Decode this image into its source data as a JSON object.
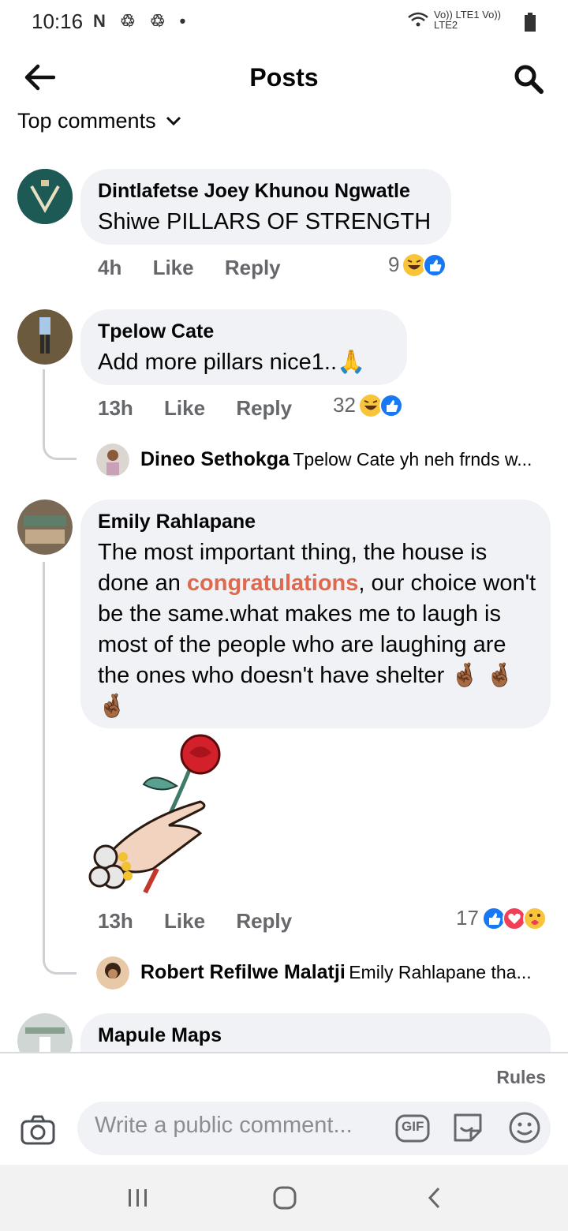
{
  "status_bar": {
    "time": "10:16",
    "network_labels": "Vo)) LTE1 Vo)) LTE2"
  },
  "header": {
    "title": "Posts",
    "sort_label": "Top comments"
  },
  "comments": [
    {
      "author": "Dintlafetse Joey Khunou Ngwatle",
      "text": "Shiwe PILLARS OF STRENGTH",
      "time": "4h",
      "like": "Like",
      "reply": "Reply",
      "reaction_count": "9"
    },
    {
      "author": "Tpelow Cate",
      "text": "Add more pillars nice1..🙏",
      "time": "13h",
      "like": "Like",
      "reply": "Reply",
      "reaction_count": "32",
      "reply_preview": {
        "author": "Dineo Sethokga",
        "text": "Tpelow Cate yh neh frnds w..."
      }
    },
    {
      "author": "Emily Rahlapane",
      "text_before": "The most important thing, the house is done an ",
      "text_highlight": "congratulations",
      "text_after": ", our choice won't be the same.what makes me to laugh is most of the people who are laughing are the ones who doesn't have shelter",
      "emojis": "🤞🏾 🤞🏾 🤞🏾",
      "time": "13h",
      "like": "Like",
      "reply": "Reply",
      "reaction_count": "17",
      "reply_preview": {
        "author": "Robert Refilwe Malatji",
        "text": "Emily Rahlapane tha..."
      }
    },
    {
      "author": "Mapule Maps"
    }
  ],
  "footer": {
    "rules": "Rules",
    "placeholder": "Write a public comment...",
    "gif_label": "GIF"
  },
  "colors": {
    "bubble": "#f0f2f5",
    "highlight": "#e0694d",
    "like_blue": "#1877f2",
    "love_red": "#f33e58"
  }
}
